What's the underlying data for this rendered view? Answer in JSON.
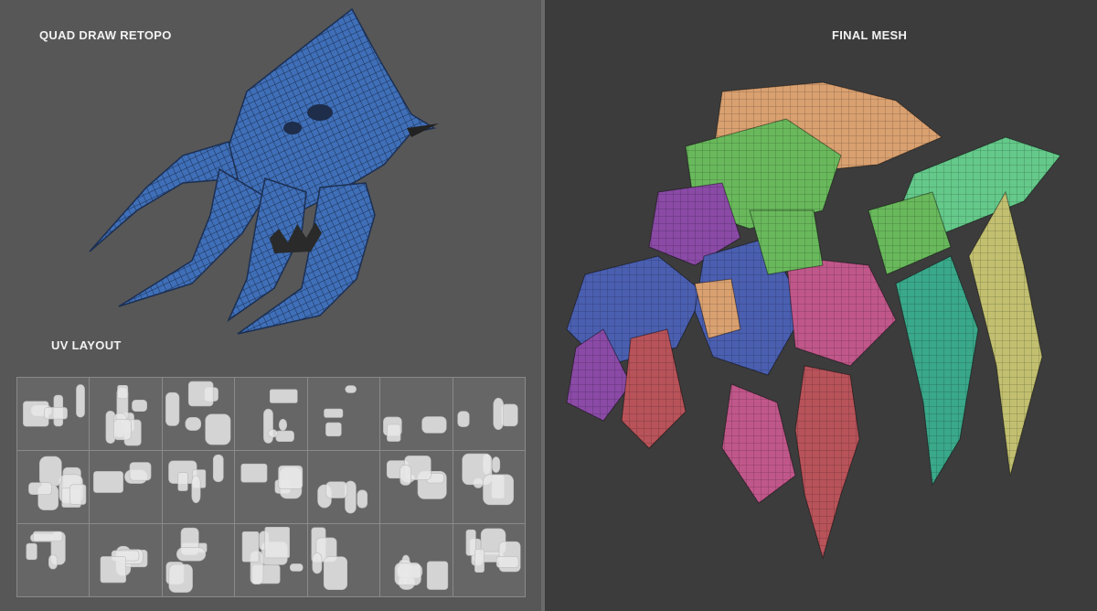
{
  "labels": {
    "retopo": "QUAD DRAW RETOPO",
    "uv": "UV LAYOUT",
    "final": "FINAL MESH"
  },
  "colors": {
    "left_bg": "#575757",
    "right_bg": "#3c3c3c",
    "retopo_mesh": "#3f6fb8",
    "uv_bg": "#666666",
    "uv_islands": "#e8e8e8",
    "polygroup_green": "#69b95c",
    "polygroup_orange": "#d9a070",
    "polygroup_purple": "#8a4aa6",
    "polygroup_blue": "#4a5fb0",
    "polygroup_pink": "#c0578a",
    "polygroup_red": "#b8535a",
    "polygroup_teal": "#3aa88a",
    "polygroup_olive": "#c2c070",
    "polygroup_mint": "#64c98a"
  },
  "uv_grid": {
    "columns": 7,
    "rows": 3
  }
}
